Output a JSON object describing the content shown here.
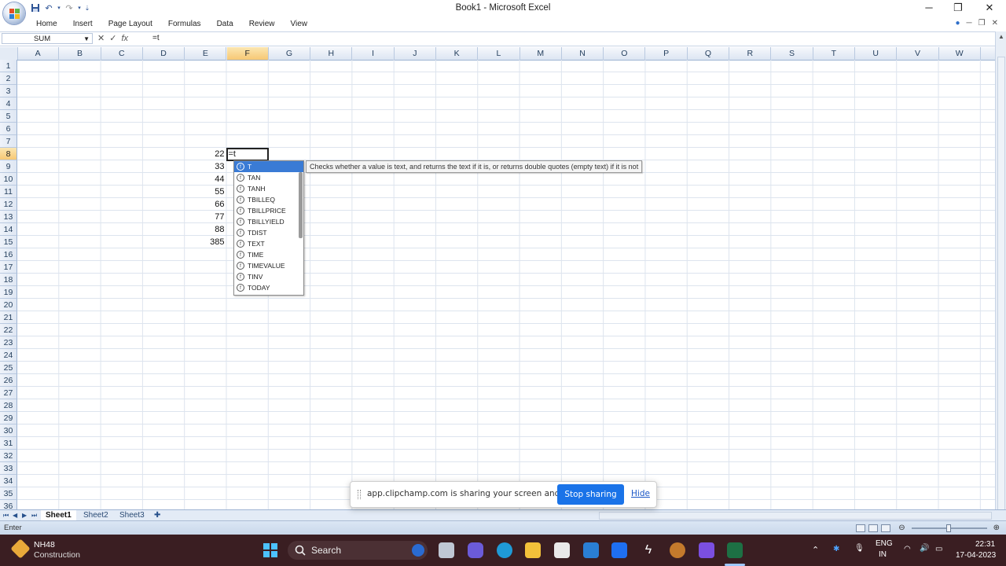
{
  "window": {
    "title": "Book1 - Microsoft Excel",
    "controls": {
      "minimize": "─",
      "restore": "❐",
      "close": "✕"
    }
  },
  "ribbon": {
    "tabs": [
      "Home",
      "Insert",
      "Page Layout",
      "Formulas",
      "Data",
      "Review",
      "View"
    ]
  },
  "formula_bar": {
    "name_box": "SUM",
    "formula": "=t",
    "icons": {
      "cancel": "✕",
      "enter": "✓",
      "fx": "fx"
    }
  },
  "grid": {
    "columns": [
      "A",
      "B",
      "C",
      "D",
      "E",
      "F",
      "G",
      "H",
      "I",
      "J",
      "K",
      "L",
      "M",
      "N",
      "O",
      "P",
      "Q",
      "R",
      "S",
      "T",
      "U",
      "V",
      "W"
    ],
    "rows": [
      "1",
      "2",
      "3",
      "4",
      "5",
      "6",
      "7",
      "8",
      "9",
      "10",
      "11",
      "12",
      "13",
      "14",
      "15",
      "16",
      "17",
      "18",
      "19",
      "20",
      "21",
      "22",
      "23",
      "24",
      "25",
      "26",
      "27",
      "28",
      "29",
      "30",
      "31",
      "32",
      "33",
      "34",
      "35",
      "36"
    ],
    "selected_column": "F",
    "selected_row": "8",
    "cells": [
      {
        "col": "E",
        "row": 8,
        "value": "22"
      },
      {
        "col": "E",
        "row": 9,
        "value": "33"
      },
      {
        "col": "E",
        "row": 10,
        "value": "44"
      },
      {
        "col": "E",
        "row": 11,
        "value": "55"
      },
      {
        "col": "E",
        "row": 12,
        "value": "66"
      },
      {
        "col": "E",
        "row": 13,
        "value": "77"
      },
      {
        "col": "E",
        "row": 14,
        "value": "88"
      },
      {
        "col": "E",
        "row": 15,
        "value": "385"
      }
    ],
    "active_cell_text": "=t"
  },
  "autocomplete": {
    "items": [
      "T",
      "TAN",
      "TANH",
      "TBILLEQ",
      "TBILLPRICE",
      "TBILLYIELD",
      "TDIST",
      "TEXT",
      "TIME",
      "TIMEVALUE",
      "TINV",
      "TODAY"
    ],
    "selected": "T",
    "tooltip": "Checks whether a value is text, and returns the text if it is, or returns double quotes (empty text) if it is not"
  },
  "sheets": {
    "tabs": [
      "Sheet1",
      "Sheet2",
      "Sheet3"
    ],
    "active": "Sheet1"
  },
  "status": {
    "mode": "Enter"
  },
  "share_banner": {
    "message": "app.clipchamp.com is sharing your screen and audio.",
    "stop_label": "Stop sharing",
    "hide_label": "Hide"
  },
  "taskbar": {
    "weather_title": "NH48",
    "weather_sub": "Construction",
    "search_label": "Search",
    "lang_top": "ENG",
    "lang_bottom": "IN",
    "time": "22:31",
    "date": "17-04-2023"
  },
  "colors": {
    "accent_blue": "#1a73e8",
    "selected_header": "#f7c874",
    "taskbar_bg": "#3a1e22"
  }
}
